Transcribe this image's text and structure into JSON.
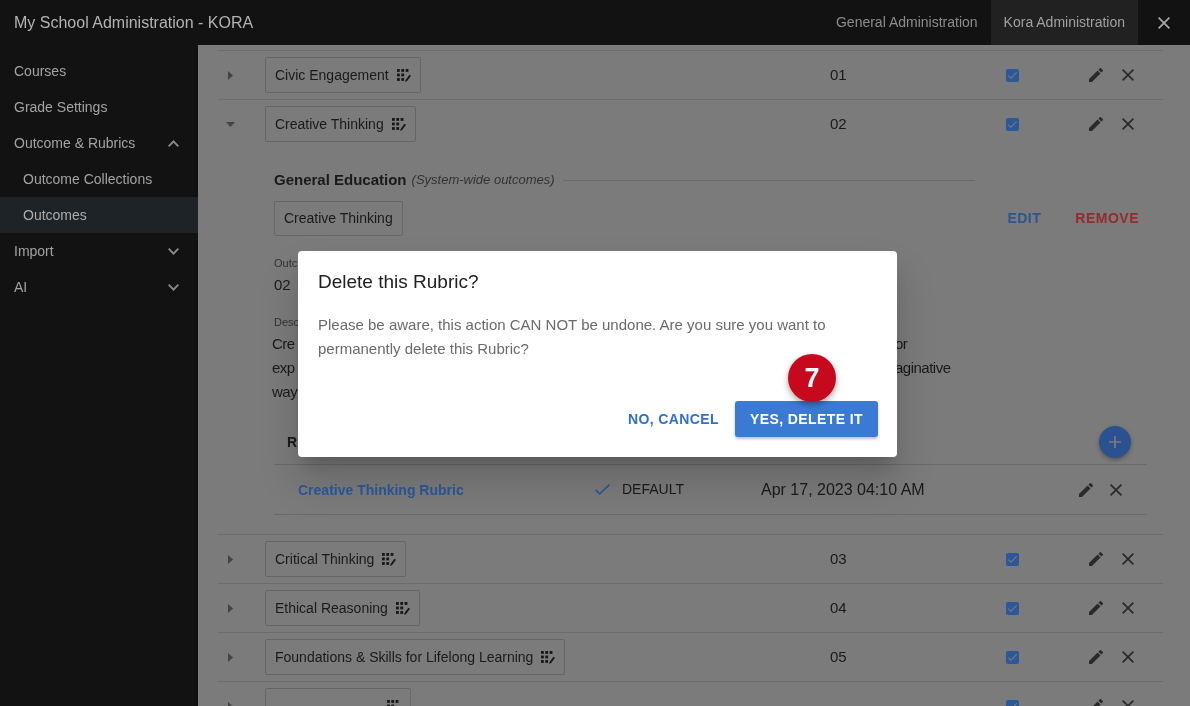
{
  "app_bar": {
    "title": "My School Administration - KORA",
    "tabs": [
      {
        "label": "General Administration",
        "selected": false
      },
      {
        "label": "Kora Administration",
        "selected": true
      }
    ]
  },
  "sidebar": {
    "items": [
      {
        "label": "Courses",
        "selected": false
      },
      {
        "label": "Grade Settings",
        "selected": false
      },
      {
        "label": "Outcome & Rubrics",
        "selected": false,
        "expanded": true,
        "children": [
          {
            "label": "Outcome Collections",
            "selected": false
          },
          {
            "label": "Outcomes",
            "selected": true
          }
        ]
      },
      {
        "label": "Import",
        "selected": false,
        "expanded": false
      },
      {
        "label": "AI",
        "selected": false,
        "expanded": false
      }
    ]
  },
  "outcomes": [
    {
      "name": "Civic Engagement",
      "code": "01",
      "checked": true,
      "expanded": false
    },
    {
      "name": "Creative Thinking",
      "code": "02",
      "checked": true,
      "expanded": true,
      "details": {
        "collection": "General Education",
        "collection_note": "(System-wide outcomes)",
        "chip": "Creative Thinking",
        "edit": "EDIT",
        "remove": "REMOVE",
        "code_label": "Outc",
        "code": "02",
        "description_label": "Desc",
        "description_lines": [
          {
            "left": "Cre",
            "right": "or"
          },
          {
            "left": "exp",
            "right": "aginative"
          },
          {
            "left": "way"
          }
        ],
        "rubrics_label": "R",
        "rubrics": [
          {
            "name": "Creative Thinking Rubric",
            "default": true,
            "default_label": "DEFAULT",
            "date": "Apr 17, 2023 04:10 AM"
          }
        ]
      }
    },
    {
      "name": "Critical Thinking",
      "code": "03",
      "checked": true,
      "expanded": false
    },
    {
      "name": "Ethical Reasoning",
      "code": "04",
      "checked": true,
      "expanded": false
    },
    {
      "name": "Foundations & Skills for Lifelong Learning",
      "code": "05",
      "checked": true,
      "expanded": false
    },
    {
      "checked": true,
      "expanded": false
    }
  ],
  "dialog": {
    "title": "Delete this Rubric?",
    "message": "Please be aware, this action CAN NOT be undone. Are you sure you want to permanently delete this Rubric?",
    "buttons": [
      {
        "label": "NO, CANCEL",
        "kind": "text"
      },
      {
        "label": "YES, DELETE IT",
        "kind": "primary"
      }
    ]
  },
  "step_badge": {
    "label": "7"
  }
}
